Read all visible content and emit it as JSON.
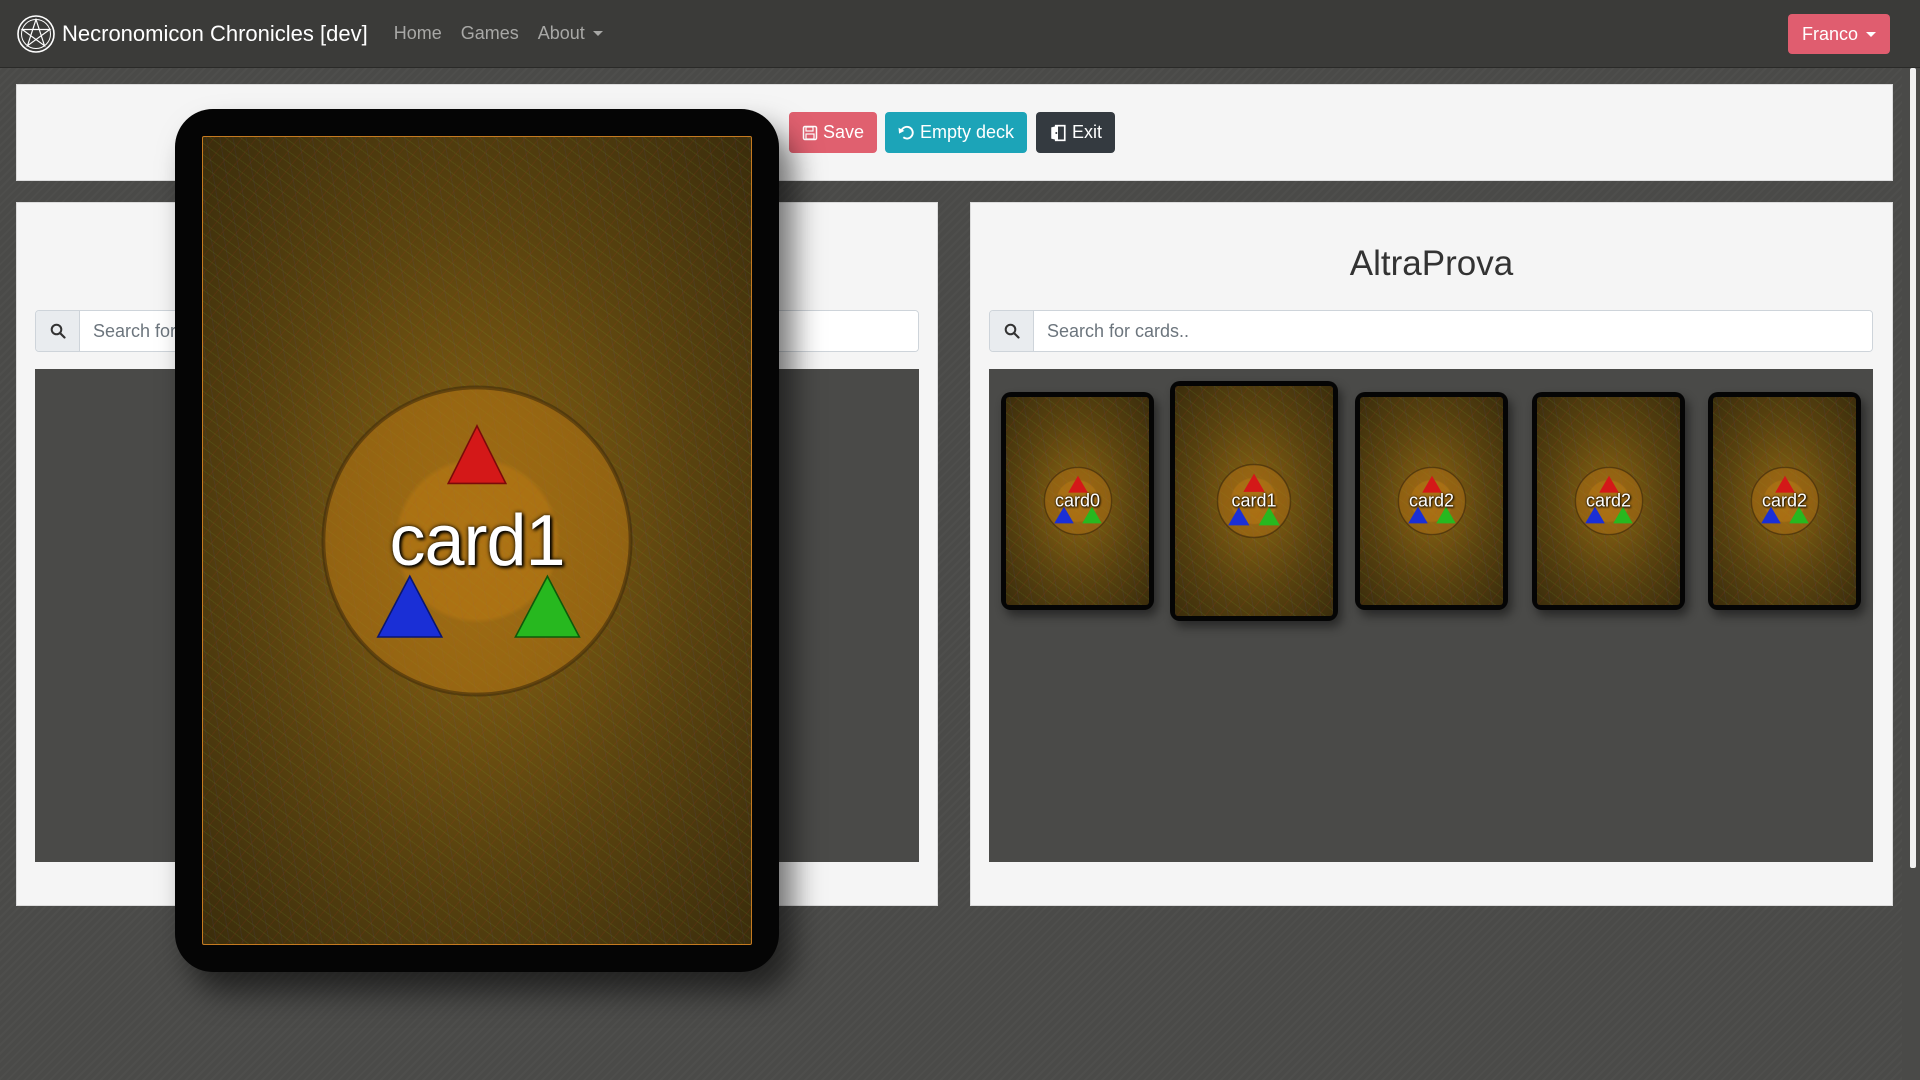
{
  "navbar": {
    "brand": "Necronomicon Chronicles [dev]",
    "links": {
      "home": "Home",
      "games": "Games",
      "about": "About"
    },
    "user": "Franco"
  },
  "toolbar": {
    "save_label": "Save",
    "empty_label": "Empty deck",
    "exit_label": "Exit"
  },
  "left_panel": {
    "search_placeholder": "Search for cards.."
  },
  "right_panel": {
    "deck_name": "AltraProva",
    "search_placeholder": "Search for cards..",
    "cards": [
      "card0",
      "card1",
      "card2",
      "card2",
      "card2"
    ]
  },
  "preview_card": {
    "label": "card1"
  },
  "colors": {
    "navbar_bg": "#3b3b39",
    "save": "#e0606f",
    "empty": "#1ca4b8",
    "exit": "#343a40",
    "user_button": "#e05d6f",
    "card_gold": "#8a6413"
  }
}
